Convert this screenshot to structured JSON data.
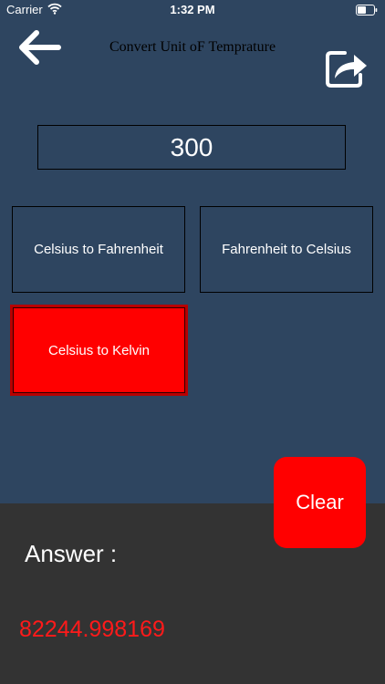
{
  "status_bar": {
    "carrier": "Carrier",
    "time": "1:32 PM",
    "wifi_icon": "wifi-icon",
    "battery_icon": "battery-icon"
  },
  "nav": {
    "title": "Convert Unit oF Temprature",
    "back_icon": "back-arrow-icon",
    "share_icon": "share-icon"
  },
  "input": {
    "value": "300"
  },
  "buttons": {
    "celsius_to_fahrenheit": "Celsius to Fahrenheit",
    "fahrenheit_to_celsius": "Fahrenheit to Celsius",
    "celsius_to_kelvin": "Celsius to Kelvin",
    "clear": "Clear"
  },
  "result": {
    "label": "Answer :",
    "value": "82244.998169"
  },
  "colors": {
    "background": "#2e4560",
    "accent_red": "#ff0000",
    "bottom_panel": "#333333"
  }
}
